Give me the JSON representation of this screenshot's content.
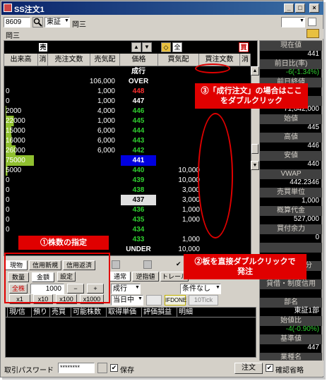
{
  "window": {
    "title": "SS注文1",
    "minimize": "_",
    "maximize": "□",
    "close": "×"
  },
  "toolbar": {
    "code": "8609",
    "market": "東証",
    "name": "岡三",
    "search_icon": "search-icon"
  },
  "tab": {
    "label": "岡三"
  },
  "board": {
    "header_icon_left": "売",
    "header_icon_right": "買",
    "center_icons": [
      "▲",
      "▼",
      "◇",
      "全"
    ],
    "columns": [
      "出来高",
      "消",
      "売注文数",
      "売気配",
      "価格",
      "買気配",
      "買注文数",
      "消"
    ],
    "rows": [
      {
        "vol": "",
        "ask": "",
        "price": "成行",
        "bid": "",
        "pc": "#ffffff",
        "pbg": ""
      },
      {
        "vol": "",
        "ask": "106,000",
        "price": "OVER",
        "bid": "",
        "pc": "#ffffff",
        "pbg": ""
      },
      {
        "vol": "0",
        "ask": "1,000",
        "price": "448",
        "bid": "",
        "pc": "#ff3030",
        "pbg": ""
      },
      {
        "vol": "0",
        "ask": "1,000",
        "price": "447",
        "bid": "",
        "pc": "#ffffff",
        "pbg": ""
      },
      {
        "vol": "2000",
        "ask": "4,000",
        "price": "446",
        "bid": "",
        "pc": "#30d030",
        "pbg": ""
      },
      {
        "vol": "22000",
        "ask": "1,000",
        "price": "445",
        "bid": "",
        "pc": "#30d030",
        "pbg": ""
      },
      {
        "vol": "15000",
        "ask": "6,000",
        "price": "444",
        "bid": "",
        "pc": "#30d030",
        "pbg": ""
      },
      {
        "vol": "16000",
        "ask": "6,000",
        "price": "443",
        "bid": "",
        "pc": "#30d030",
        "pbg": ""
      },
      {
        "vol": "26000",
        "ask": "6,000",
        "price": "442",
        "bid": "",
        "pc": "#30d030",
        "pbg": ""
      },
      {
        "vol": "75000",
        "ask": "",
        "price": "441",
        "bid": "",
        "pc": "#ffffff",
        "pbg": "#0000e0"
      },
      {
        "vol": "5000",
        "ask": "",
        "price": "440",
        "bid": "10,000",
        "pc": "#30d030",
        "pbg": ""
      },
      {
        "vol": "0",
        "ask": "",
        "price": "439",
        "bid": "10,000",
        "pc": "#30d030",
        "pbg": ""
      },
      {
        "vol": "0",
        "ask": "",
        "price": "438",
        "bid": "3,000",
        "pc": "#30d030",
        "pbg": ""
      },
      {
        "vol": "0",
        "ask": "",
        "price": "437",
        "bid": "3,000",
        "pc": "#000000",
        "pbg": "#e0e0e0"
      },
      {
        "vol": "0",
        "ask": "",
        "price": "436",
        "bid": "1,000",
        "pc": "#30d030",
        "pbg": ""
      },
      {
        "vol": "0",
        "ask": "",
        "price": "435",
        "bid": "1,000",
        "pc": "#30d030",
        "pbg": ""
      },
      {
        "vol": "0",
        "ask": "",
        "price": "434",
        "bid": "",
        "pc": "#30d030",
        "pbg": ""
      },
      {
        "vol": "",
        "ask": "",
        "price": "433",
        "bid": "1,000",
        "pc": "#30d030",
        "pbg": ""
      },
      {
        "vol": "",
        "ask": "",
        "price": "UNDER",
        "bid": "10,000",
        "pc": "#ffffff",
        "pbg": ""
      }
    ]
  },
  "panel": [
    {
      "label": "現在値",
      "value": "441",
      "vc": "#ffffff"
    },
    {
      "label": "前日比(率)",
      "value": "-6(-1.34%)",
      "vc": "#30d030"
    },
    {
      "label": "前日終値",
      "value": "",
      "vc": "#ffffff"
    },
    {
      "label": "売買代金",
      "value": "71,642,000",
      "vc": "#ffffff"
    },
    {
      "label": "始値",
      "value": "445",
      "vc": "#ffffff"
    },
    {
      "label": "高値",
      "value": "446",
      "vc": "#ffffff"
    },
    {
      "label": "安値",
      "value": "440",
      "vc": "#ffffff"
    },
    {
      "label": "VWAP",
      "value": "442.2346",
      "vc": "#ffffff"
    },
    {
      "label": "売買単位",
      "value": "1,000",
      "vc": "#ffffff"
    },
    {
      "label": "概算代金",
      "value": "527,000",
      "vc": "#ffffff"
    },
    {
      "label": "買付余力",
      "value": "0",
      "vc": "#ffffff"
    },
    {
      "label": "",
      "value": "",
      "vc": "#ffffff"
    },
    {
      "label": "信用貸借区分",
      "value": "",
      "vc": "#ffffff"
    },
    {
      "label": "貸借・制度信用",
      "value": "",
      "vc": "#ffffff"
    },
    {
      "label": "部名",
      "value": "東証1部",
      "vc": "#ffffff"
    },
    {
      "label": "始値比",
      "value": "-4(-0.90%)",
      "vc": "#30d030"
    },
    {
      "label": "基準値",
      "value": "447",
      "vc": "#ffffff"
    },
    {
      "label": "業種名",
      "value": "",
      "vc": "#ffffff"
    }
  ],
  "order": {
    "tabs": [
      "現物",
      "信用新規",
      "信用返済"
    ],
    "qty_tab": "数量",
    "amount_tab": "金額",
    "settings_btn": "設定",
    "all_btn": "全株",
    "qty_value": "1000",
    "minus_btn": "−",
    "plus_btn": "+",
    "mult": [
      "x1",
      "x10",
      "x100",
      "x1000"
    ],
    "order_type_tabs": [
      "通常",
      "逆指値",
      "トレール"
    ],
    "market_select": "成行",
    "condition_select": "条件なし",
    "period_select": "当日中",
    "ifdone": "IFDONE",
    "tick": "10Tick"
  },
  "list": {
    "columns": [
      "現/信",
      "預り",
      "売買",
      "可能株数",
      "取得単価",
      "評価損益",
      "明細"
    ]
  },
  "footer": {
    "pw_label": "取引パスワード",
    "pw_value": "********",
    "save_label": "保存",
    "order_btn": "注文",
    "confirm_label": "確認省略"
  },
  "annotations": {
    "a1": "①株数の指定",
    "a2": "②板を直接ダブルクリックで発注",
    "a3": "③「成行注文」の場合はここをダブルクリック"
  }
}
